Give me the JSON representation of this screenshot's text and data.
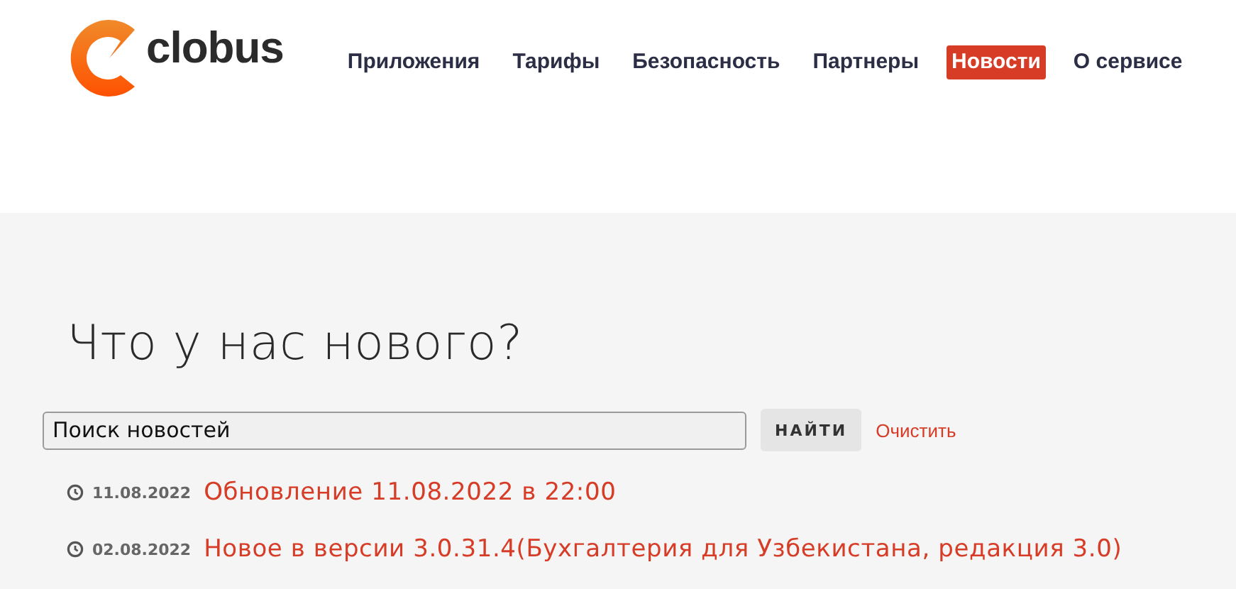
{
  "logo": {
    "text": "clobus"
  },
  "nav": [
    {
      "label": "Приложения",
      "selected": false
    },
    {
      "label": "Тарифы",
      "selected": false
    },
    {
      "label": "Безопасность",
      "selected": false
    },
    {
      "label": "Партнеры",
      "selected": false
    },
    {
      "label": "Новости",
      "selected": true
    },
    {
      "label": "О сервисе",
      "selected": false
    }
  ],
  "heading": "Что у нас нового?",
  "search": {
    "value": "Поиск новостей",
    "button": "НАЙТИ",
    "clear": "Очистить"
  },
  "news": [
    {
      "date": "11.08.2022",
      "title": "Обновление 11.08.2022 в 22:00"
    },
    {
      "date": "02.08.2022",
      "title": "Новое в версии 3.0.31.4(Бухгалтерия для Узбекистана, редакция 3.0)"
    }
  ]
}
